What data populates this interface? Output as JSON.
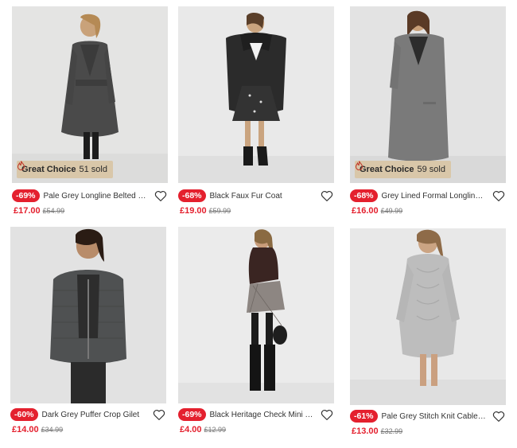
{
  "colors": {
    "discount_red": "#e4202e",
    "price_red": "#e4202e",
    "badge_beige": "#d9c7a9"
  },
  "products": [
    {
      "name": "Pale Grey Longline Belted Coat",
      "discount": "-69%",
      "price": "£17.00",
      "was": "£54.99",
      "badge": {
        "title": "Great Choice",
        "sold": "51 sold",
        "icon": "flame-icon"
      }
    },
    {
      "name": "Black Faux Fur Coat",
      "discount": "-68%",
      "price": "£19.00",
      "was": "£59.99"
    },
    {
      "name": "Grey Lined Formal Longline Coat",
      "discount": "-68%",
      "price": "£16.00",
      "was": "£49.99",
      "badge": {
        "title": "Great Choice",
        "sold": "59 sold",
        "icon": "flame-icon"
      }
    },
    {
      "name": "Dark Grey Puffer Crop Gilet",
      "discount": "-60%",
      "price": "£14.00",
      "was": "£34.99"
    },
    {
      "name": "Black Heritage Check Mini Tube Skirt",
      "discount": "-69%",
      "price": "£4.00",
      "was": "£12.99"
    },
    {
      "name": "Pale Grey Stitch Knit Cable Front Jumper Dress",
      "discount": "-61%",
      "price": "£13.00",
      "was": "£32.99"
    }
  ]
}
